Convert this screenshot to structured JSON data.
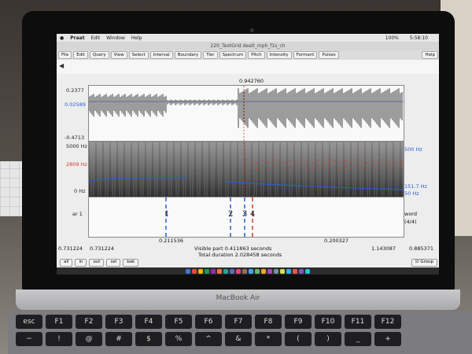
{
  "menubar": {
    "app": "Praat",
    "items": [
      "Edit",
      "Window",
      "Help"
    ],
    "status": [
      "100%",
      "5:58:10"
    ]
  },
  "window": {
    "title": "220_TextGrid dealt_mph_f1s_ch"
  },
  "toolbar": {
    "buttons": [
      "File",
      "Edit",
      "Query",
      "View",
      "Select",
      "Interval",
      "Boundary",
      "Tier",
      "Spectrum",
      "Pitch",
      "Intensity",
      "Formant",
      "Pulses"
    ],
    "help": "Help"
  },
  "waveform": {
    "cursor_time": "0.942760",
    "y_top": "0.2377",
    "y_mid": "0.02589",
    "y_bottom": "-0.4713"
  },
  "spectrogram": {
    "left_top": "5000 Hz",
    "left_mid": "2809 Hz",
    "left_bottom": "0 Hz",
    "right_top": "500 Hz",
    "right_mid": "151.7 Hz",
    "right_bottom": "50 Hz"
  },
  "tier": {
    "left_label": "ar 1",
    "right_label": "word",
    "right_count": "(4/4)",
    "intervals": [
      "1",
      "2",
      "3",
      "4"
    ]
  },
  "time_axis": {
    "seg_left": "0.211536",
    "seg_right": "0.200327",
    "start": "0.731224",
    "start_blue": "0.731224",
    "visible": "Visible part 0.411863 seconds",
    "end_blue": "1.143087",
    "end": "0.885371",
    "total": "Total duration 2.028458 seconds"
  },
  "bottom_buttons": [
    "all",
    "in",
    "out",
    "sel",
    "bak"
  ],
  "group_label": "Group",
  "laptop_label": "MacBook Air",
  "keyboard_row": [
    "esc",
    "F1",
    "F2",
    "F3",
    "F4",
    "F5",
    "F6",
    "F7",
    "F8",
    "F9",
    "F10",
    "F11",
    "F12"
  ],
  "keyboard_row2": [
    "~",
    "!",
    "@",
    "#",
    "$",
    "%",
    "^",
    "&",
    "*",
    "(",
    ")",
    "_",
    "+"
  ],
  "colors": {
    "accent_red": "#d03a2a",
    "accent_blue": "#2b5ccf"
  }
}
